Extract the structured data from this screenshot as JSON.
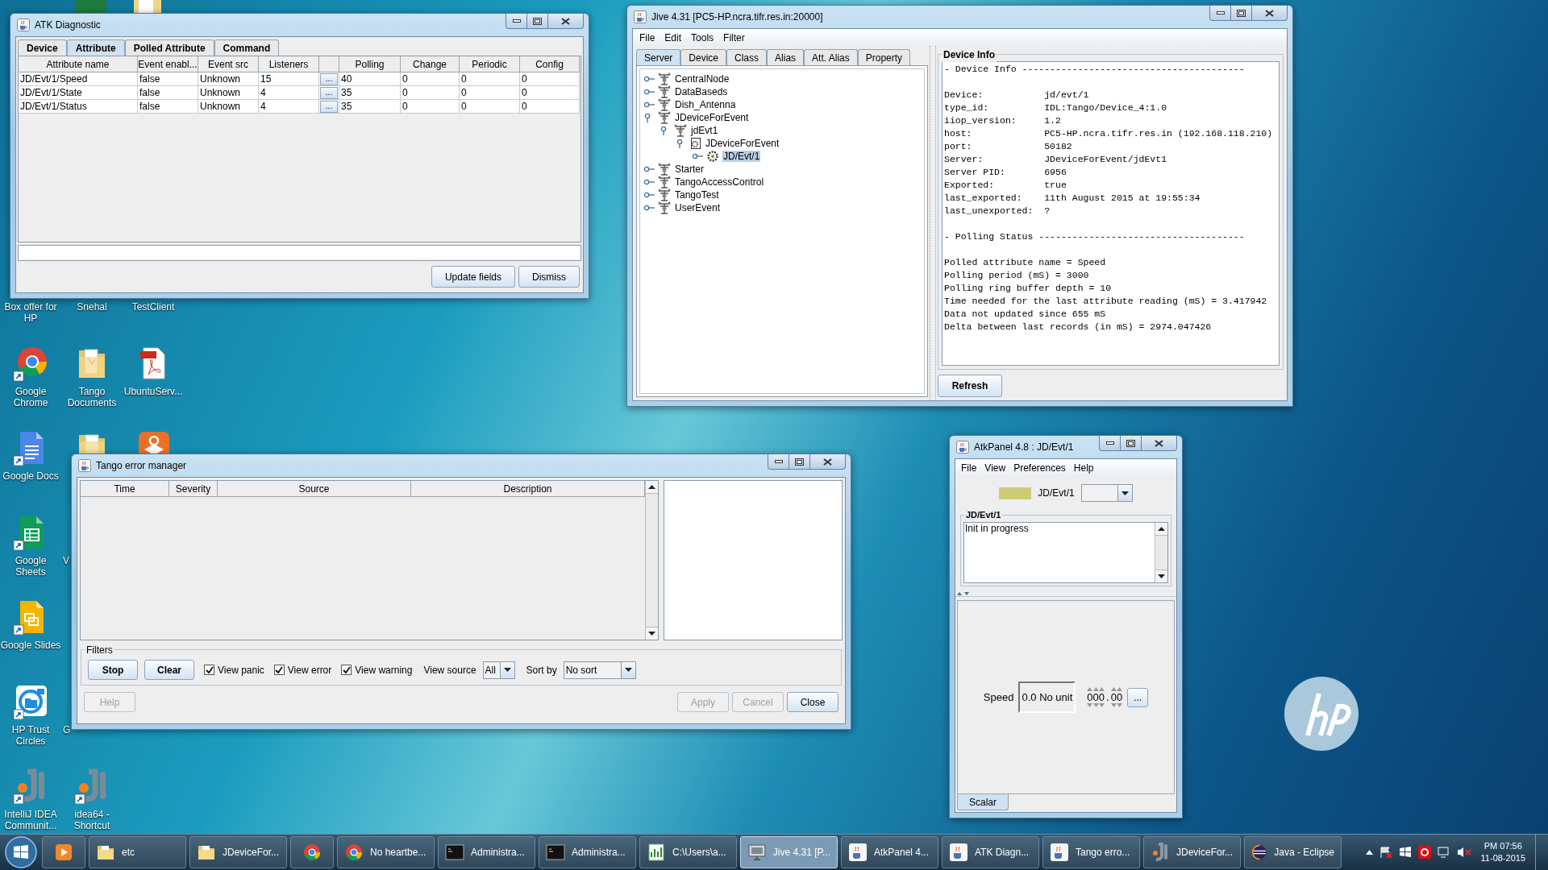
{
  "desktop_icon_rows": [
    [
      {
        "label": "Box offer for HP"
      },
      {
        "label": "Snehal"
      },
      {
        "label": "TestClient"
      }
    ],
    [
      {
        "kind": "chrome",
        "label": "Google Chrome"
      },
      {
        "kind": "folder_docs",
        "label": "Tango Documents"
      },
      {
        "kind": "pdf",
        "label": "UbuntuServ..."
      }
    ],
    [
      {
        "kind": "doc",
        "label": "Google Docs"
      },
      {
        "kind": "folder"
      },
      {
        "kind": "package"
      }
    ],
    [
      {
        "kind": "sheet",
        "label": "Google Sheets"
      },
      {
        "kind": "cut_label",
        "label": "V"
      }
    ],
    [
      {
        "kind": "slide",
        "label": "Google Slides"
      }
    ],
    [
      {
        "kind": "trust",
        "label": "HP Trust Circles"
      },
      {
        "kind": "cut_label",
        "label": "G"
      }
    ],
    [
      {
        "kind": "intellij",
        "label": "IntelliJ IDEA Communit..."
      },
      {
        "kind": "intellij",
        "label": "idea64 - Shortcut"
      }
    ]
  ],
  "atk_diagnostic": {
    "title": "ATK Diagnostic",
    "tabs": [
      {
        "label": "Device",
        "selected": false
      },
      {
        "label": "Attribute",
        "selected": true
      },
      {
        "label": "Polled Attribute",
        "selected": false
      },
      {
        "label": "Command",
        "selected": false
      }
    ],
    "columns": [
      "Attribute name",
      "Event enabl...",
      "Event src",
      "Listeners",
      "Polling",
      "Change",
      "Periodic",
      "Config"
    ],
    "rows": [
      {
        "cells": [
          "JD/Evt/1/Speed",
          "false",
          "Unknown",
          "15",
          "40",
          "0",
          "0",
          "0"
        ],
        "button": "..."
      },
      {
        "cells": [
          "JD/Evt/1/State",
          "false",
          "Unknown",
          "4",
          "35",
          "0",
          "0",
          "0"
        ],
        "button": "..."
      },
      {
        "cells": [
          "JD/Evt/1/Status",
          "false",
          "Unknown",
          "4",
          "35",
          "0",
          "0",
          "0"
        ],
        "button": "..."
      }
    ],
    "buttons": [
      "Update fields",
      "Dismiss"
    ]
  },
  "jive": {
    "title": "Jive 4.31 [PC5-HP.ncra.tifr.res.in:20000]",
    "menu": [
      "File",
      "Edit",
      "Tools",
      "Filter"
    ],
    "tabs": [
      {
        "label": "Server",
        "selected": true
      },
      {
        "label": "Device",
        "selected": false
      },
      {
        "label": "Class",
        "selected": false
      },
      {
        "label": "Alias",
        "selected": false
      },
      {
        "label": "Att. Alias",
        "selected": false
      },
      {
        "label": "Property",
        "selected": false
      }
    ],
    "tree": [
      {
        "label": "CentralNode",
        "kind": "server",
        "expanded": false,
        "selected": false
      },
      {
        "label": "DataBaseds",
        "kind": "server",
        "expanded": false,
        "selected": false
      },
      {
        "label": "Dish_Antenna",
        "kind": "server",
        "expanded": false,
        "selected": false
      },
      {
        "label": "JDeviceForEvent",
        "kind": "server",
        "expanded": true,
        "selected": false,
        "children": [
          {
            "label": "jdEvt1",
            "kind": "server",
            "expanded": true,
            "selected": false,
            "children": [
              {
                "label": "JDeviceForEvent",
                "kind": "class",
                "expanded": true,
                "selected": false,
                "children": [
                  {
                    "label": "JD/Evt/1",
                    "kind": "device",
                    "expanded": false,
                    "selected": true
                  }
                ]
              }
            ]
          }
        ]
      },
      {
        "label": "Starter",
        "kind": "server",
        "expanded": false,
        "selected": false
      },
      {
        "label": "TangoAccessControl",
        "kind": "server",
        "expanded": false,
        "selected": false
      },
      {
        "label": "TangoTest",
        "kind": "server",
        "expanded": false,
        "selected": false
      },
      {
        "label": "UserEvent",
        "kind": "server",
        "expanded": false,
        "selected": false
      }
    ],
    "device_info": {
      "title": "Device Info",
      "sections": [
        {
          "heading": "- Device Info ----------------------------------------",
          "fields": [
            {
              "key": "Device:",
              "value": "jd/evt/1"
            },
            {
              "key": "type_id:",
              "value": "IDL:Tango/Device_4:1.0"
            },
            {
              "key": "iiop_version:",
              "value": "1.2"
            },
            {
              "key": "host:",
              "value": "PC5-HP.ncra.tifr.res.in (192.168.118.210)"
            },
            {
              "key": "port:",
              "value": "50182"
            },
            {
              "key": "Server:",
              "value": "JDeviceForEvent/jdEvt1"
            },
            {
              "key": "Server PID:",
              "value": "6956"
            },
            {
              "key": "Exported:",
              "value": "true"
            },
            {
              "key": "last_exported:",
              "value": "11th August 2015 at 19:55:34"
            },
            {
              "key": "last_unexported:",
              "value": "?"
            }
          ]
        },
        {
          "heading": "- Polling Status -------------------------------------",
          "lines": [
            "Polled attribute name = Speed",
            "Polling period (mS) = 3000",
            "Polling ring buffer depth = 10",
            "Time needed for the last attribute reading (mS) = 3.417942",
            "Data not updated since 655 mS",
            "Delta between last records (in mS) = 2974.047426"
          ]
        }
      ]
    },
    "refresh_button": "Refresh"
  },
  "error_manager": {
    "title": "Tango error manager",
    "columns": [
      "Time",
      "Severity",
      "Source",
      "Description"
    ],
    "filters": {
      "title": "Filters",
      "buttons": [
        "Stop",
        "Clear"
      ],
      "checkboxes": [
        {
          "label": "View panic",
          "checked": true
        },
        {
          "label": "View error",
          "checked": true
        },
        {
          "label": "View warning",
          "checked": true
        }
      ],
      "view_source": {
        "label": "View source",
        "value": "All"
      },
      "sort_by": {
        "label": "Sort by",
        "value": "No sort"
      }
    },
    "buttons": [
      {
        "label": "Help",
        "disabled": true
      },
      {
        "label": "Apply",
        "disabled": true
      },
      {
        "label": "Cancel",
        "disabled": true
      },
      {
        "label": "Close",
        "disabled": false
      }
    ]
  },
  "atk_panel": {
    "title": "AtkPanel 4.8 : JD/Evt/1",
    "menu": [
      "File",
      "View",
      "Preferences",
      "Help"
    ],
    "device": "JD/Evt/1",
    "status": {
      "title": "JD/Evt/1",
      "text": "Init in progress"
    },
    "attribute": {
      "label": "Speed",
      "value": "0.0 No unit",
      "wheel": {
        "integer": [
          "0",
          "0",
          "0"
        ],
        "separator": ".",
        "fraction": [
          "0",
          "0"
        ]
      },
      "button": "..."
    },
    "tabs": [
      {
        "label": "Scalar",
        "selected": true
      }
    ]
  },
  "taskbar": {
    "items": [
      {
        "kind": "media",
        "selected": false
      },
      {
        "kind": "folder",
        "label": "etc",
        "selected": false
      },
      {
        "kind": "folder",
        "label": "JDeviceFor...",
        "selected": false
      },
      {
        "kind": "chrome",
        "selected": false
      },
      {
        "kind": "chrome",
        "label": "No heartbe...",
        "selected": false
      },
      {
        "kind": "cmd",
        "label": "Administra...",
        "selected": false
      },
      {
        "kind": "cmd",
        "label": "Administra...",
        "selected": false
      },
      {
        "kind": "chart",
        "label": "C:\\Users\\a...",
        "selected": false
      },
      {
        "kind": "monitor",
        "label": "Jive 4.31 [P...",
        "selected": true
      },
      {
        "kind": "java",
        "label": "AtkPanel 4...",
        "selected": false
      },
      {
        "kind": "java",
        "label": "ATK Diagn...",
        "selected": false
      },
      {
        "kind": "java",
        "label": "Tango erro...",
        "selected": false
      },
      {
        "kind": "intellij",
        "label": "JDeviceFor...",
        "selected": false
      },
      {
        "kind": "eclipse",
        "label": "Java - Eclipse",
        "selected": false
      }
    ],
    "clock": {
      "time": "PM 07:56",
      "date": "11-08-2015"
    }
  }
}
